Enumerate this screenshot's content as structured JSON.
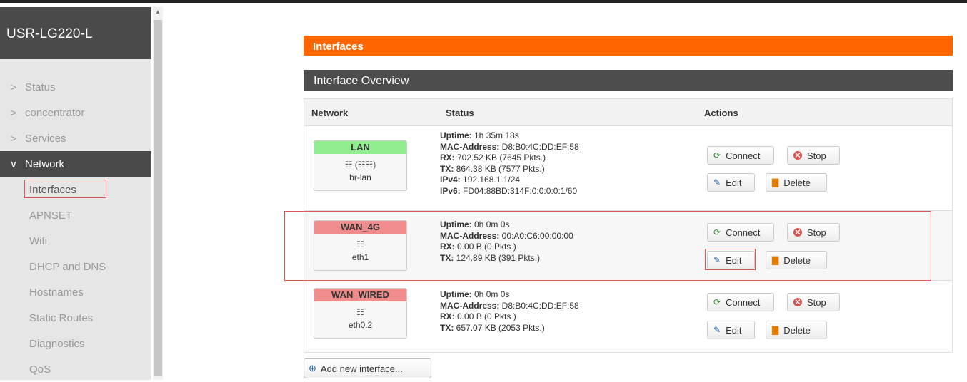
{
  "sidebar": {
    "brand": "USR-LG220-L",
    "items": [
      {
        "label": "Status",
        "chev": ">"
      },
      {
        "label": "concentrator",
        "chev": ">"
      },
      {
        "label": "Services",
        "chev": ">"
      },
      {
        "label": "Network",
        "chev": "∨"
      }
    ],
    "subitems": [
      "Interfaces",
      "APNSET",
      "Wifi",
      "DHCP and DNS",
      "Hostnames",
      "Static Routes",
      "Diagnostics",
      "QoS"
    ]
  },
  "page": {
    "title": "Interfaces",
    "section": "Interface Overview"
  },
  "table": {
    "headers": {
      "network": "Network",
      "status": "Status",
      "actions": "Actions"
    },
    "rows": [
      {
        "name": "LAN",
        "icons": "☷ (☷☷)",
        "device": "br-lan",
        "status": [
          {
            "k": "Uptime:",
            "v": " 1h 35m 18s"
          },
          {
            "k": "MAC-Address:",
            "v": " D8:B0:4C:DD:EF:58"
          },
          {
            "k": "RX:",
            "v": " 702.52 KB (7645 Pkts.)"
          },
          {
            "k": "TX:",
            "v": " 864.38 KB (7577 Pkts.)"
          },
          {
            "k": "IPv4:",
            "v": " 192.168.1.1/24"
          },
          {
            "k": "IPv6:",
            "v": " FD04:88BD:314F:0:0:0:0:1/60"
          }
        ]
      },
      {
        "name": "WAN_4G",
        "icons": "☷",
        "device": "eth1",
        "status": [
          {
            "k": "Uptime:",
            "v": " 0h 0m 0s"
          },
          {
            "k": "MAC-Address:",
            "v": " 00:A0:C6:00:00:00"
          },
          {
            "k": "RX:",
            "v": " 0.00 B (0 Pkts.)"
          },
          {
            "k": "TX:",
            "v": " 124.89 KB (391 Pkts.)"
          }
        ]
      },
      {
        "name": "WAN_WIRED",
        "icons": "☷",
        "device": "eth0.2",
        "status": [
          {
            "k": "Uptime:",
            "v": " 0h 0m 0s"
          },
          {
            "k": "MAC-Address:",
            "v": " D8:B0:4C:DD:EF:58"
          },
          {
            "k": "RX:",
            "v": " 0.00 B (0 Pkts.)"
          },
          {
            "k": "TX:",
            "v": " 657.07 KB (2053 Pkts.)"
          }
        ]
      }
    ],
    "buttons": {
      "connect": "Connect",
      "stop": "Stop",
      "edit": "Edit",
      "delete": "Delete"
    }
  },
  "add_button": "Add new interface...",
  "colors": {
    "accent": "#ff6600",
    "header_dark": "#4d4d4d",
    "up": "#90ee90",
    "down": "#f08c8c",
    "highlight": "#e25555"
  }
}
